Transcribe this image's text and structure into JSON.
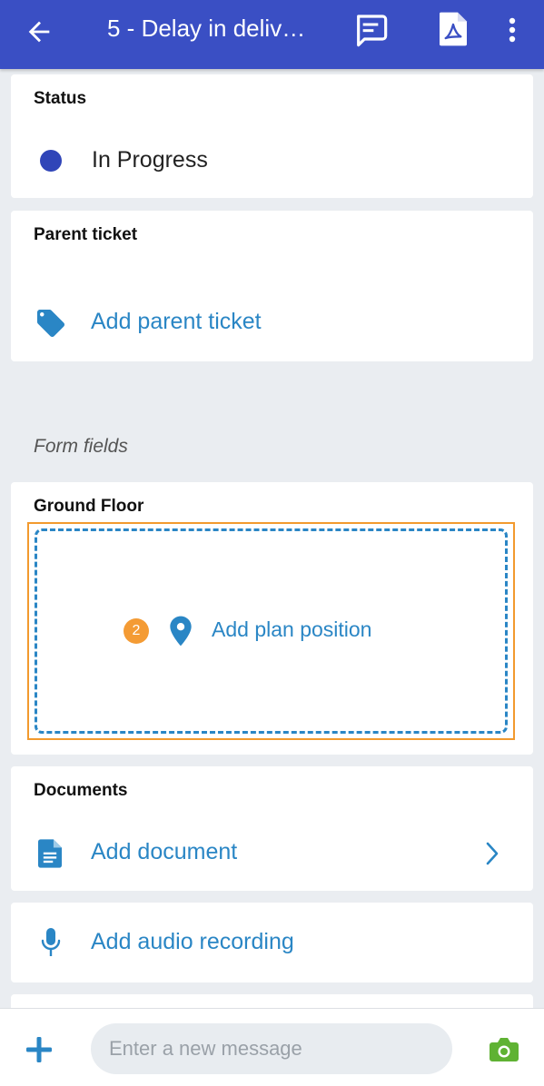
{
  "header": {
    "title": "5 - Delay in deliv…",
    "icons": [
      "back-arrow-icon",
      "chat-icon",
      "pdf-icon",
      "more-vert-icon"
    ],
    "color": "#3a4fc4"
  },
  "status": {
    "title": "Status",
    "value": "In Progress",
    "dot_color": "#3045b8"
  },
  "parent_ticket": {
    "title": "Parent ticket",
    "action": "Add parent ticket",
    "icon": "tag-icon"
  },
  "form_fields": {
    "label": "Form fields",
    "ground_floor": {
      "title": "Ground Floor",
      "badge": "2",
      "action": "Add plan position",
      "icon": "location-pin-icon"
    }
  },
  "documents": {
    "title": "Documents",
    "action": "Add document",
    "icon": "document-icon"
  },
  "audio": {
    "action": "Add audio recording",
    "icon": "microphone-icon"
  },
  "composer": {
    "placeholder": "Enter a new message",
    "icons": [
      "plus-icon",
      "camera-icon"
    ]
  },
  "colors": {
    "link": "#2a86c5",
    "highlight_border": "#f29a2e",
    "badge": "#f49b34",
    "camera": "#5fb233"
  }
}
